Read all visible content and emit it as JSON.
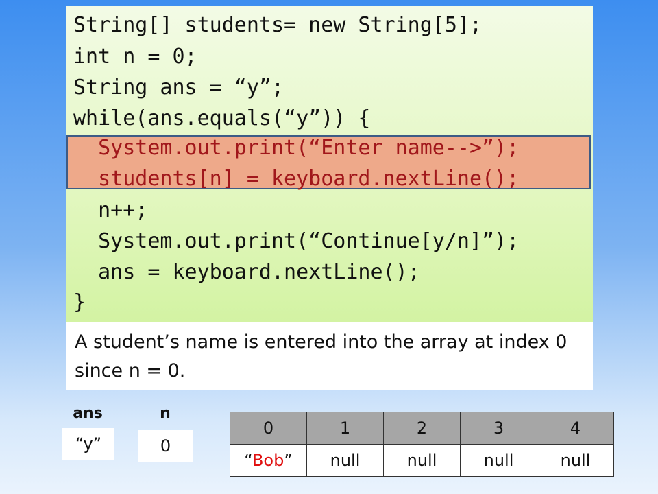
{
  "code": {
    "lines": [
      "String[] students= new String[5];",
      "int n = 0;",
      "String ans = “y”;",
      "while(ans.equals(“y”)) {",
      "  System.out.print(“Enter name-->”);",
      "  students[n] = keyboard.nextLine();",
      "  n++;",
      "  System.out.print(“Continue[y/n]”);",
      "  ans = keyboard.nextLine();",
      "}"
    ],
    "highlight_color": "#eea98a",
    "highlight_text_color": "#a1171b"
  },
  "caption": "A student’s name is entered into the array at index 0 since n = 0.",
  "variables": {
    "ans": {
      "label": "ans",
      "value": "“y”"
    },
    "n": {
      "label": "n",
      "value": "0"
    }
  },
  "array": {
    "indices": [
      "0",
      "1",
      "2",
      "3",
      "4"
    ],
    "values": [
      {
        "open": "“",
        "text": "Bob",
        "close": "”"
      },
      {
        "text": "null"
      },
      {
        "text": "null"
      },
      {
        "text": "null"
      },
      {
        "text": "null"
      }
    ],
    "highlight_value_color": "#e01010"
  }
}
